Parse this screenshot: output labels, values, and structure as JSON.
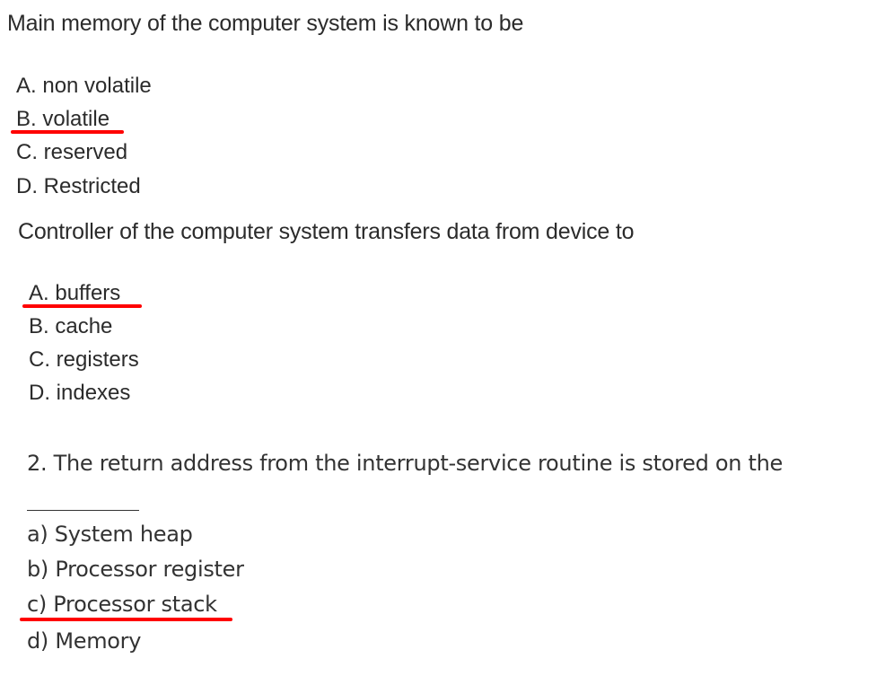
{
  "accent_color": "#ff0000",
  "q1": {
    "question": "Main memory of the computer system is known to be",
    "options": [
      "A. non volatile",
      "B. volatile",
      "C. reserved",
      "D. Restricted"
    ],
    "marked_answer": "B. volatile"
  },
  "q2": {
    "question": "Controller of the computer system transfers data from device to",
    "options": [
      "A. buffers",
      "B. cache",
      "C. registers",
      "D. indexes"
    ],
    "marked_answer": "A. buffers"
  },
  "q3": {
    "question": "2. The return address from the interrupt-service routine is stored on the",
    "options": [
      "a) System heap",
      "b) Processor register",
      "c) Processor stack",
      "d) Memory"
    ],
    "marked_answer": "c) Processor stack"
  }
}
